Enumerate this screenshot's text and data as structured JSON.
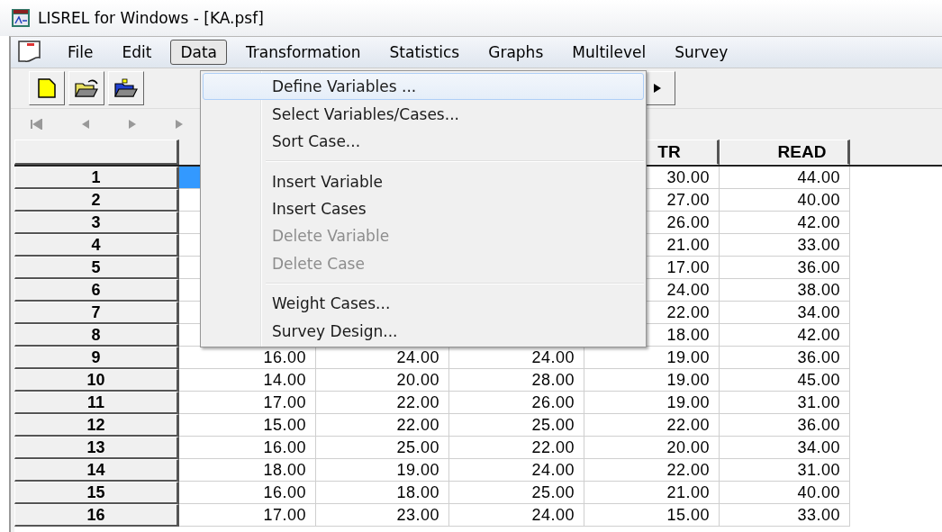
{
  "window": {
    "title": "LISREL for Windows - [KA.psf]"
  },
  "menu_bar": [
    {
      "label": "File",
      "selected": false
    },
    {
      "label": "Edit",
      "selected": false
    },
    {
      "label": "Data",
      "selected": true
    },
    {
      "label": "Transformation",
      "selected": false
    },
    {
      "label": "Statistics",
      "selected": false
    },
    {
      "label": "Graphs",
      "selected": false
    },
    {
      "label": "Multilevel",
      "selected": false
    },
    {
      "label": "Survey",
      "selected": false
    }
  ],
  "data_menu": [
    {
      "kind": "item",
      "label": "Define Variables ...",
      "selected": true,
      "disabled": false
    },
    {
      "kind": "item",
      "label": "Select Variables/Cases...",
      "selected": false,
      "disabled": false
    },
    {
      "kind": "item",
      "label": "Sort Case...",
      "selected": false,
      "disabled": false
    },
    {
      "kind": "separator"
    },
    {
      "kind": "item",
      "label": "Insert Variable",
      "selected": false,
      "disabled": false
    },
    {
      "kind": "item",
      "label": "Insert Cases",
      "selected": false,
      "disabled": false
    },
    {
      "kind": "item",
      "label": "Delete Variable",
      "selected": false,
      "disabled": true
    },
    {
      "kind": "item",
      "label": "Delete Case",
      "selected": false,
      "disabled": true
    },
    {
      "kind": "separator"
    },
    {
      "kind": "item",
      "label": "Weight Cases...",
      "selected": false,
      "disabled": false
    },
    {
      "kind": "item",
      "label": "Survey Design...",
      "selected": false,
      "disabled": false
    }
  ],
  "table": {
    "columns": [
      null,
      null,
      null,
      "TR",
      "READ"
    ],
    "rows": [
      {
        "label": "1",
        "selected": true,
        "cells": [
          null,
          null,
          null,
          "30.00",
          "44.00"
        ]
      },
      {
        "label": "2",
        "selected": false,
        "cells": [
          null,
          null,
          null,
          "27.00",
          "40.00"
        ]
      },
      {
        "label": "3",
        "selected": false,
        "cells": [
          null,
          null,
          null,
          "26.00",
          "42.00"
        ]
      },
      {
        "label": "4",
        "selected": false,
        "cells": [
          null,
          null,
          null,
          "21.00",
          "33.00"
        ]
      },
      {
        "label": "5",
        "selected": false,
        "cells": [
          null,
          null,
          null,
          "17.00",
          "36.00"
        ]
      },
      {
        "label": "6",
        "selected": false,
        "cells": [
          null,
          null,
          null,
          "24.00",
          "38.00"
        ]
      },
      {
        "label": "7",
        "selected": false,
        "cells": [
          null,
          null,
          null,
          "22.00",
          "34.00"
        ]
      },
      {
        "label": "8",
        "selected": false,
        "cells": [
          null,
          null,
          null,
          "18.00",
          "42.00"
        ]
      },
      {
        "label": "9",
        "selected": false,
        "cells": [
          "16.00",
          "24.00",
          "24.00",
          "19.00",
          "36.00"
        ]
      },
      {
        "label": "10",
        "selected": false,
        "cells": [
          "14.00",
          "20.00",
          "28.00",
          "19.00",
          "45.00"
        ]
      },
      {
        "label": "11",
        "selected": false,
        "cells": [
          "17.00",
          "22.00",
          "26.00",
          "19.00",
          "31.00"
        ]
      },
      {
        "label": "12",
        "selected": false,
        "cells": [
          "15.00",
          "22.00",
          "25.00",
          "22.00",
          "36.00"
        ]
      },
      {
        "label": "13",
        "selected": false,
        "cells": [
          "16.00",
          "25.00",
          "22.00",
          "20.00",
          "34.00"
        ]
      },
      {
        "label": "14",
        "selected": false,
        "cells": [
          "18.00",
          "19.00",
          "24.00",
          "22.00",
          "31.00"
        ]
      },
      {
        "label": "15",
        "selected": false,
        "cells": [
          "16.00",
          "18.00",
          "25.00",
          "21.00",
          "40.00"
        ]
      },
      {
        "label": "16",
        "selected": false,
        "cells": [
          "17.00",
          "23.00",
          "24.00",
          "15.00",
          "33.00"
        ]
      }
    ]
  }
}
